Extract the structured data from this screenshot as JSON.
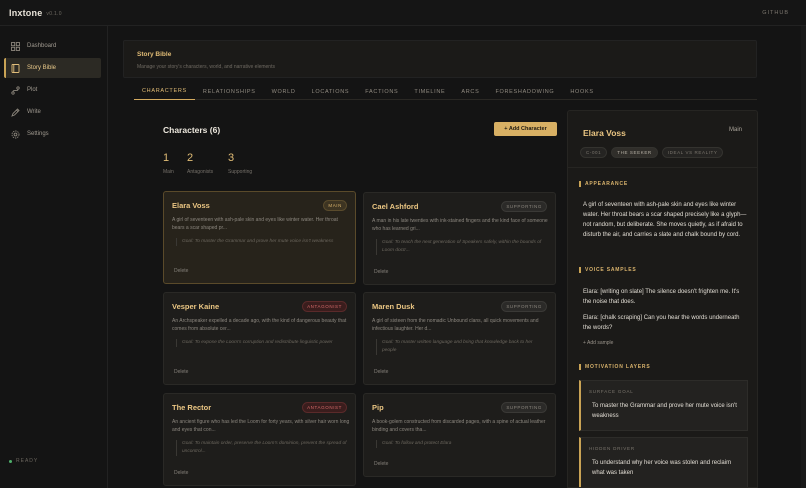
{
  "app": {
    "name": "Inxtone",
    "version": "v0.1.0",
    "github": "GITHUB"
  },
  "sidebar": {
    "items": [
      {
        "label": "Dashboard",
        "icon": "grid-icon"
      },
      {
        "label": "Story Bible",
        "icon": "book-icon"
      },
      {
        "label": "Plot",
        "icon": "plot-icon"
      },
      {
        "label": "Write",
        "icon": "pen-icon"
      },
      {
        "label": "Settings",
        "icon": "gear-icon"
      }
    ],
    "status": "READY"
  },
  "page": {
    "title": "Story Bible",
    "subtitle": "Manage your story's characters, world, and narrative elements"
  },
  "tabs": [
    "CHARACTERS",
    "RELATIONSHIPS",
    "WORLD",
    "LOCATIONS",
    "FACTIONS",
    "TIMELINE",
    "ARCS",
    "FORESHADOWING",
    "HOOKS"
  ],
  "characters": {
    "heading": "Characters (6)",
    "add_label": "+ Add Character",
    "stats": [
      {
        "num": "1",
        "label": "Main"
      },
      {
        "num": "2",
        "label": "Antagonists"
      },
      {
        "num": "3",
        "label": "Supporting"
      }
    ],
    "cards": [
      {
        "name": "Elara Voss",
        "role": "MAIN",
        "desc": "A girl of seventeen with ash-pale skin and eyes like winter water. Her throat bears a scar shaped pr...",
        "goal": "Goal: To master the Grammar and prove her mute voice isn't weakness",
        "delete": "Delete"
      },
      {
        "name": "Cael Ashford",
        "role": "SUPPORTING",
        "desc": "A man in his late twenties with ink-stained fingers and the kind face of someone who has learned gri...",
        "goal": "Goal: To teach the next generation of Speakers safely, within the bounds of Loom doctr...",
        "delete": "Delete"
      },
      {
        "name": "Vesper Kaine",
        "role": "ANTAGONIST",
        "desc": "An Archspeaker expelled a decade ago, with the kind of dangerous beauty that comes from absolute cer...",
        "goal": "Goal: To expose the Loom's corruption and redistribute linguistic power",
        "delete": "Delete"
      },
      {
        "name": "Maren Dusk",
        "role": "SUPPORTING",
        "desc": "A girl of sixteen from the nomadic Unbound clans, all quick movements and infectious laughter. Her d...",
        "goal": "Goal: To master written language and bring that knowledge back to her people",
        "delete": "Delete"
      },
      {
        "name": "The Rector",
        "role": "ANTAGONIST",
        "desc": "An ancient figure who has led the Loom for forty years, with silver hair worn long and eyes that con...",
        "goal": "Goal: To maintain order, preserve the Loom's dominion, prevent the spread of uncontrol...",
        "delete": "Delete"
      },
      {
        "name": "Pip",
        "role": "SUPPORTING",
        "desc": "A book-golem constructed from discarded pages, with a spine of actual leather binding and covers tha...",
        "goal": "Goal: To follow and protect Elara",
        "delete": "Delete"
      }
    ]
  },
  "detail": {
    "name": "Elara Voss",
    "role": "Main",
    "chips": [
      "C-001",
      "THE SEEKER",
      "IDEAL VS REALITY"
    ],
    "appearance_title": "APPEARANCE",
    "appearance": "A girl of seventeen with ash-pale skin and eyes like winter water. Her throat bears a scar shaped precisely like a glyph—not random, but deliberate. She moves quietly, as if afraid to disturb the air, and carries a slate and chalk bound by cord.",
    "voice_title": "VOICE SAMPLES",
    "voice": [
      "Elara: [writing on slate] The silence doesn't frighten me. It's the noise that does.",
      "Elara: [chalk scraping] Can you hear the words underneath the words?"
    ],
    "add_sample": "+ Add sample",
    "motivation_title": "MOTIVATION LAYERS",
    "layers": [
      {
        "title": "SURFACE GOAL",
        "value": "To master the Grammar and prove her mute voice isn't weakness"
      },
      {
        "title": "HIDDEN DRIVER",
        "value": "To understand why her voice was stolen and reclaim what was taken"
      }
    ]
  },
  "colors": {
    "accent": "#d8b064",
    "antagonist": "#d56a6a",
    "ready": "#4fb06b"
  }
}
